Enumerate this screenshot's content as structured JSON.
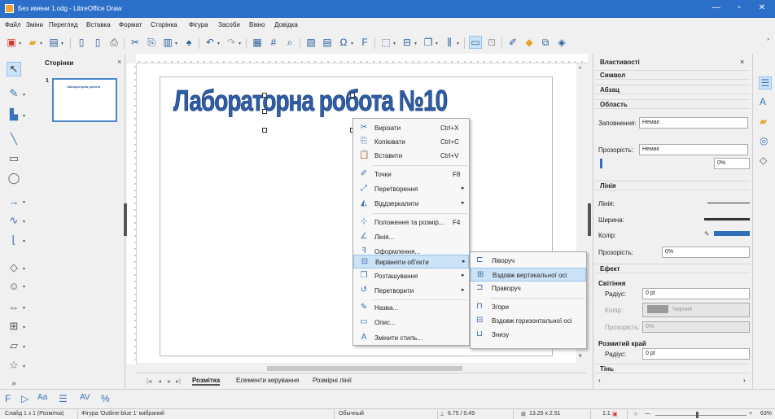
{
  "window": {
    "title": "Без имени 1.odg - LibreOffice Draw",
    "controls": [
      "—",
      "▫",
      "✕"
    ]
  },
  "menu": [
    "Файл",
    "Зміни",
    "Перегляд",
    "Вставка",
    "Формат",
    "Сторінка",
    "Фігура",
    "Засоби",
    "Вікно",
    "Довідка"
  ],
  "pages_panel": {
    "title": "Сторінки",
    "close": "×",
    "page_number": "1",
    "thumb_text": "Лабораторна робота"
  },
  "drawing": {
    "fontwork_text": "Лабораторна робота №10"
  },
  "context_menu": {
    "items": [
      {
        "label": "Вирізати",
        "shortcut": "Ctrl+X",
        "icon": "scissors-icon",
        "glyph": "✂"
      },
      {
        "label": "Копіювати",
        "shortcut": "Ctrl+C",
        "icon": "copy-icon",
        "glyph": "⎘"
      },
      {
        "label": "Вставити",
        "shortcut": "Ctrl+V",
        "icon": "paste-icon",
        "glyph": "📋"
      },
      {
        "label": "Точки",
        "shortcut": "F8",
        "icon": "points-icon",
        "glyph": "✐"
      },
      {
        "label": "Перетворення",
        "shortcut": "",
        "icon": "transform-icon",
        "glyph": "⤢",
        "submenu": true
      },
      {
        "label": "Віддзеркалити",
        "shortcut": "",
        "icon": "mirror-icon",
        "glyph": "◭",
        "submenu": true
      },
      {
        "label": "Положення та розмір...",
        "shortcut": "F4",
        "icon": "position-size-icon",
        "glyph": "⊹"
      },
      {
        "label": "Лінія...",
        "shortcut": "",
        "icon": "line-icon",
        "glyph": "∠"
      },
      {
        "label": "Оформлення...",
        "shortcut": "",
        "icon": "style-icon",
        "glyph": "ꟻ"
      },
      {
        "label": "Вирівняти об'єкти",
        "shortcut": "",
        "icon": "align-icon",
        "glyph": "⊟",
        "submenu": true,
        "highlight": true
      },
      {
        "label": "Розташування",
        "shortcut": "",
        "icon": "arrange-icon",
        "glyph": "❐",
        "submenu": true
      },
      {
        "label": "Перетворити",
        "shortcut": "",
        "icon": "convert-icon",
        "glyph": "↺",
        "submenu": true
      },
      {
        "label": "Назва...",
        "shortcut": "",
        "icon": "name-icon",
        "glyph": "✎"
      },
      {
        "label": "Опис...",
        "shortcut": "",
        "icon": "description-icon",
        "glyph": "▭"
      },
      {
        "label": "Змінити стиль...",
        "shortcut": "",
        "icon": "edit-style-icon",
        "glyph": "A"
      }
    ]
  },
  "align_submenu": {
    "items": [
      {
        "label": "Ліворуч",
        "icon": "align-left-icon",
        "glyph": "⊏"
      },
      {
        "label": "Вздовж вертикальної осі",
        "icon": "align-center-icon",
        "glyph": "⊞",
        "highlight": true
      },
      {
        "label": "Праворуч",
        "icon": "align-right-icon",
        "glyph": "⊐"
      },
      {
        "label": "Згори",
        "icon": "align-top-icon",
        "glyph": "⊓"
      },
      {
        "label": "Вздовж горизонтальної осі",
        "icon": "align-middle-icon",
        "glyph": "⊟"
      },
      {
        "label": "Знизу",
        "icon": "align-bottom-icon",
        "glyph": "⊔"
      }
    ]
  },
  "tabs": {
    "items": [
      "Розмітка",
      "Елементи керування",
      "Розмірні лінії"
    ],
    "active": "Розмітка"
  },
  "sidebar": {
    "title": "Властивості",
    "sections": {
      "character": "Символ",
      "paragraph": "Абзац",
      "area": "Область",
      "line": "Лінія",
      "effect": "Ефект",
      "shadow": "Тінь"
    },
    "area": {
      "fill_label": "Заповнення:",
      "fill_value": "Немає",
      "transparency_label": "Прозорість:",
      "transparency_value": "Немає",
      "percent": "0%"
    },
    "line": {
      "line_label": "Лінія:",
      "width_label": "Ширина:",
      "color_label": "Колір:",
      "transparency_label": "Прозорість:",
      "transparency_value": "0%"
    },
    "glow": {
      "title": "Світіння",
      "radius_label": "Радіус:",
      "radius_value": "0 pt",
      "color_label": "Колір:",
      "color_value": "Чорний",
      "transparency_label": "Прозорість:",
      "transparency_value": "0%"
    },
    "soft_edge": {
      "title": "Розмитий край",
      "radius_label": "Радіус:",
      "radius_value": "0 pt"
    }
  },
  "status": {
    "slide": "Слайд 1 з 1 (Розмітка)",
    "selection": "Фігура 'Outline-blue 1' вибраний",
    "style": "Обычный",
    "position": "6.75 / 0.49",
    "size": "13.25 x 2.51",
    "scale": "1:1",
    "zoom": "63%"
  },
  "colors": {
    "accent": "#2b6fc9",
    "fontwork": "#2e5ea8",
    "line_color": "#2e6fba"
  }
}
